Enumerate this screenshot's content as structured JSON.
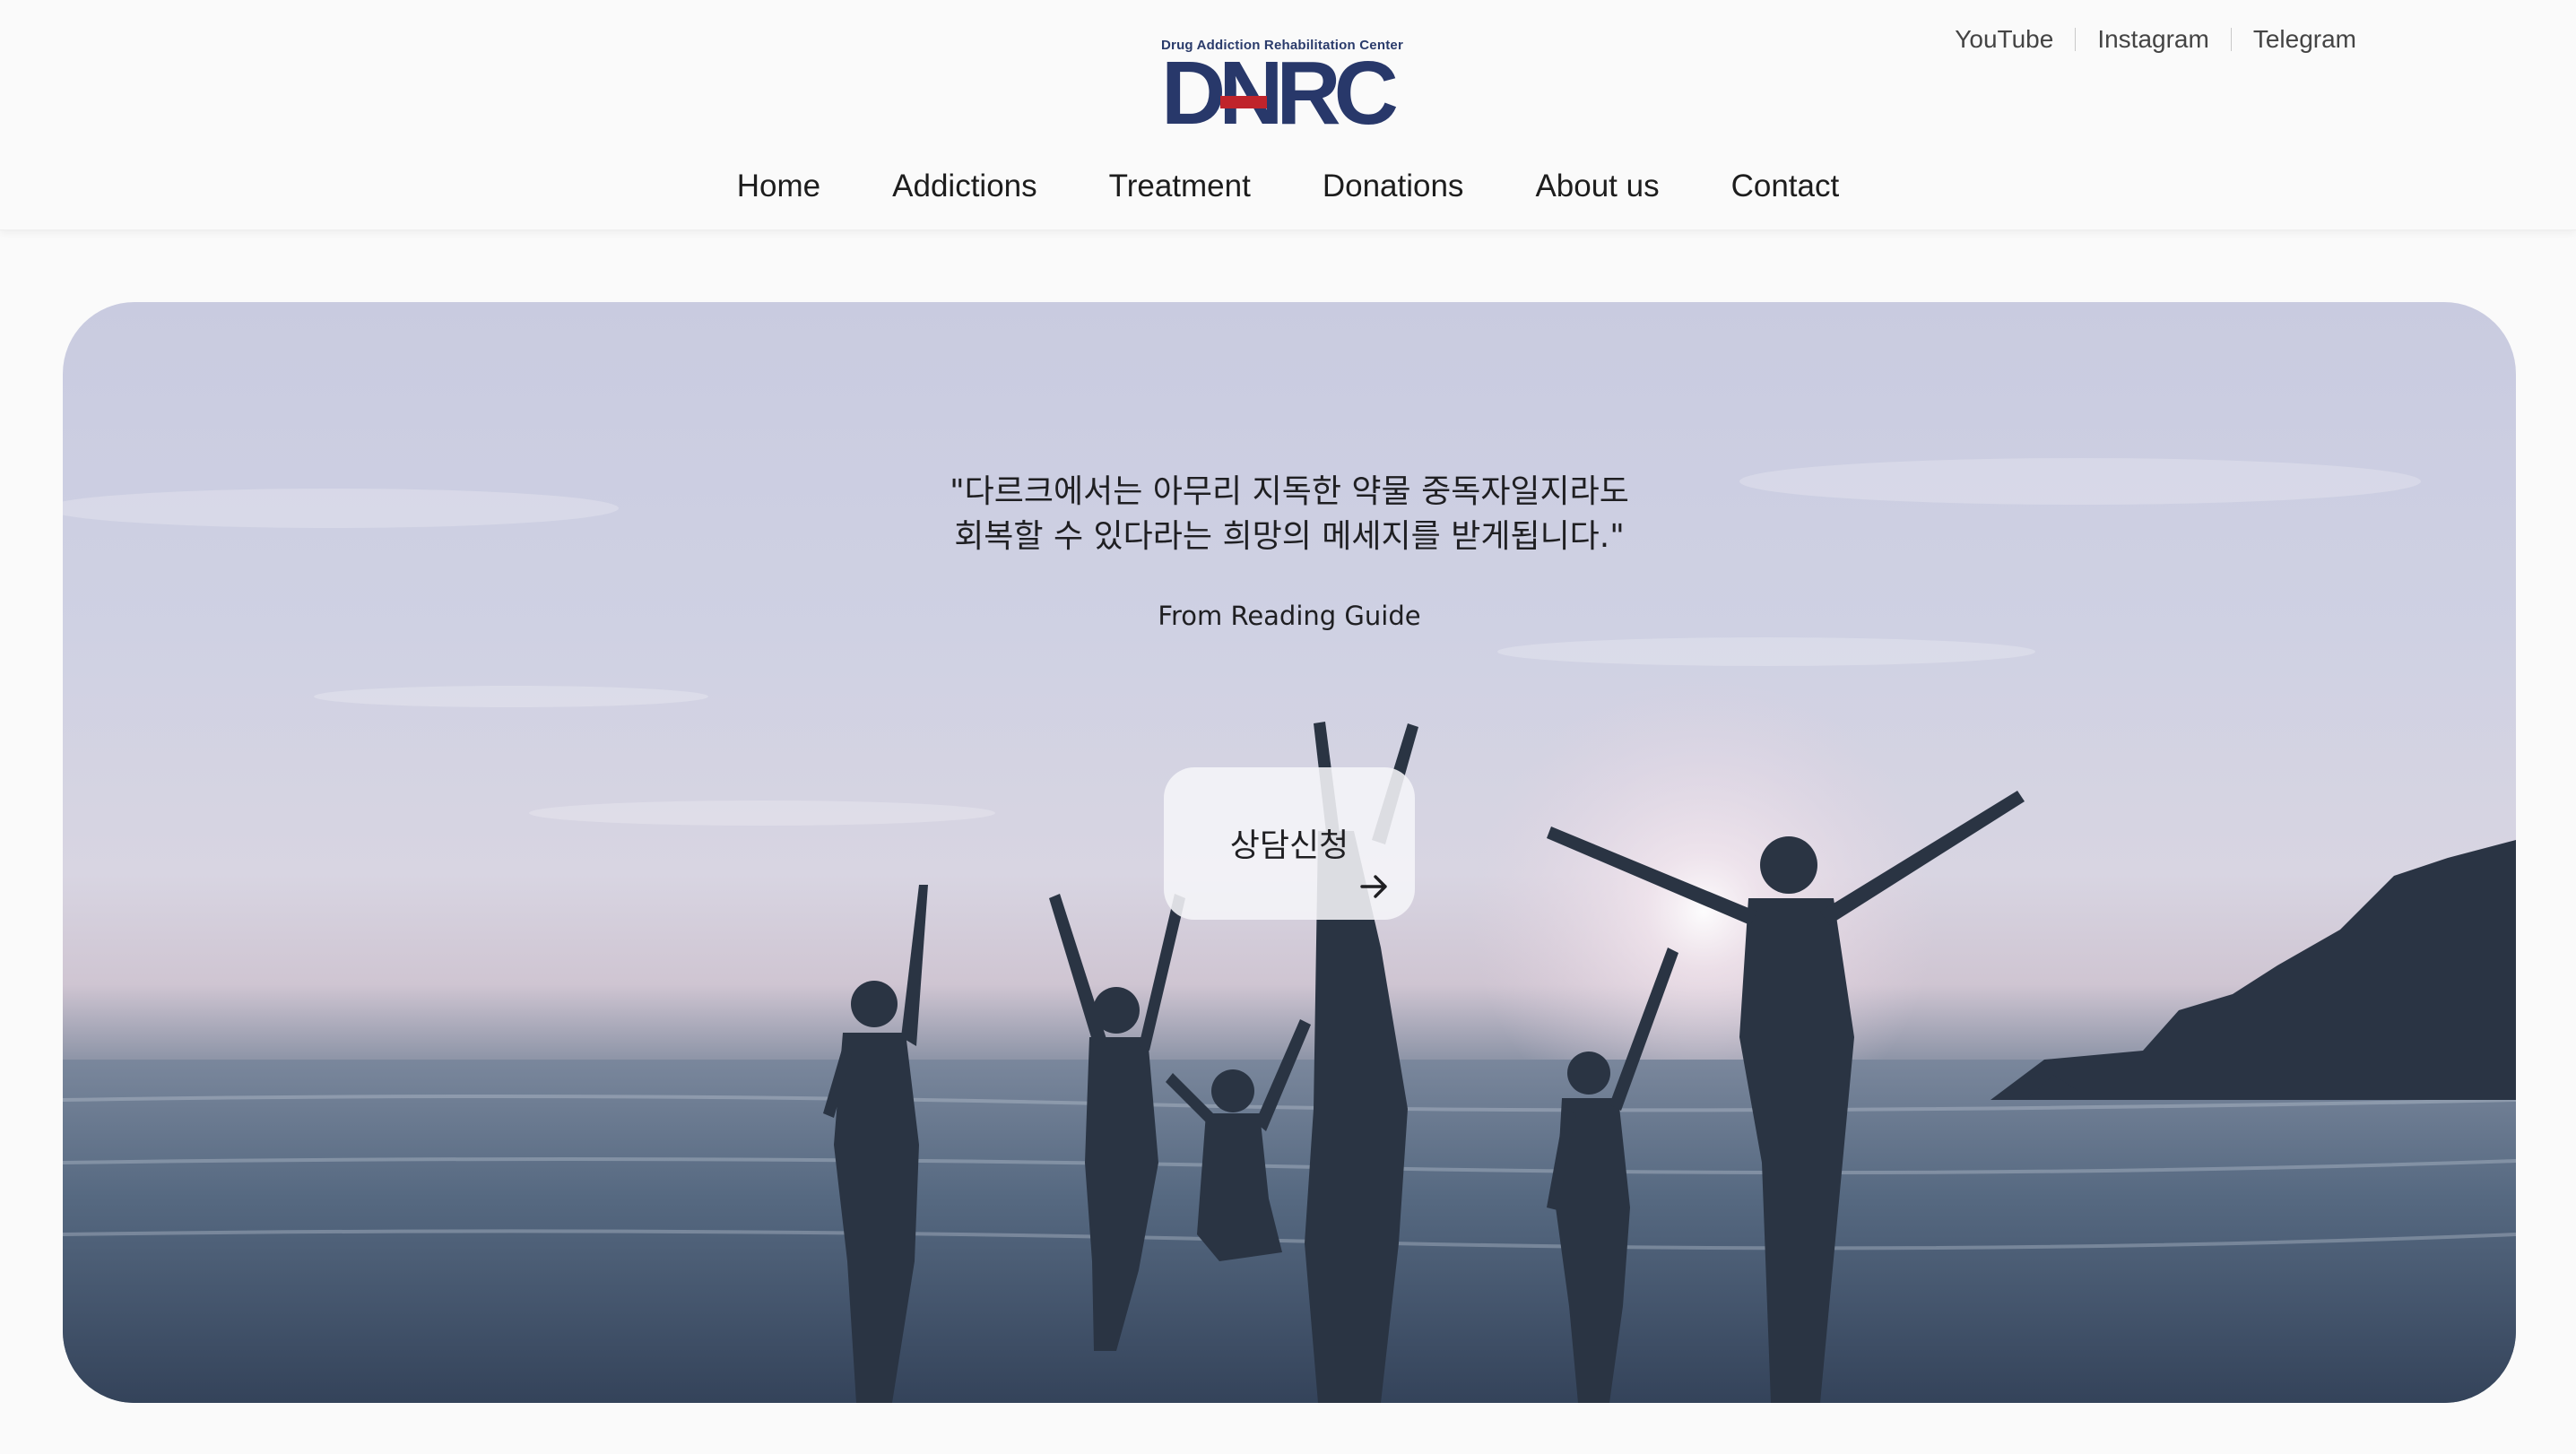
{
  "header": {
    "logo": {
      "subtitle": "Drug Addiction Rehabilitation Center",
      "wordmark": "DNRC"
    },
    "social": [
      {
        "label": "YouTube"
      },
      {
        "label": "Instagram"
      },
      {
        "label": "Telegram"
      }
    ],
    "nav": [
      {
        "label": "Home"
      },
      {
        "label": "Addictions"
      },
      {
        "label": "Treatment"
      },
      {
        "label": "Donations"
      },
      {
        "label": "About us"
      },
      {
        "label": "Contact"
      }
    ]
  },
  "hero": {
    "quote_line1": "\"다르크에서는 아무리 지독한 약물 중독자일지라도",
    "quote_line2": "회복할 수 있다라는 희망의 메세지를 받게됩니다.\"",
    "source": "From Reading Guide",
    "cta_label": "상담신청",
    "cta_icon": "arrow-right-icon"
  },
  "colors": {
    "brand_navy": "#28386a",
    "brand_red": "#c0242b",
    "page_background": "#fafafa"
  }
}
